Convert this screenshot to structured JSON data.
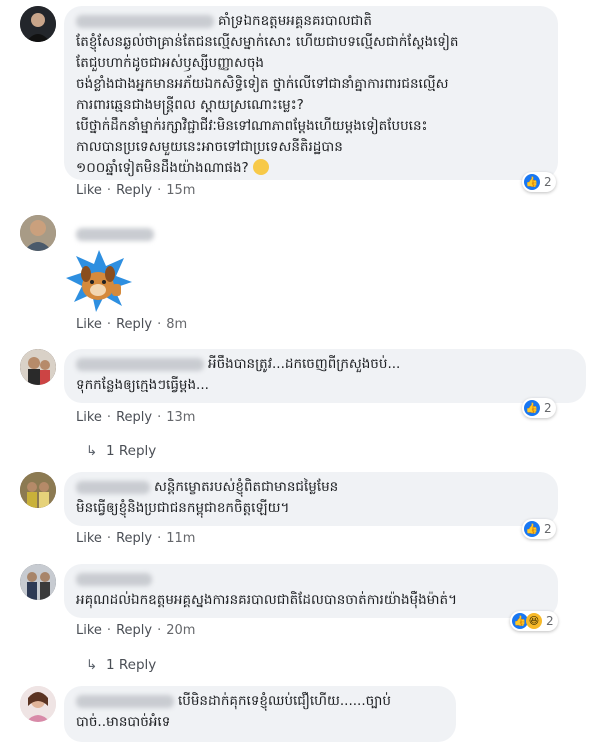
{
  "labels": {
    "like": "Like",
    "reply": "Reply",
    "dot": "·"
  },
  "comments": [
    {
      "lines": [
        "គាំទ្រឯកឧត្តមអគ្គនគរបាលជាតិ",
        "តែខ្ញុំសែនឆ្ងល់ថាគ្រាន់តែជនល្មើសម្នាក់សោះ ហើយជាបទល្មើសជាក់ស្តែងទៀត",
        "តែជួបហាក់ដូចជាអស់ឫស្សីបញ្ញាសចុង",
        "ចង់ខ្លាំងជាងអ្នកមានអភ័យឯកសិទ្ធិទៀត ថ្នាក់លើទៅជានាំគ្នាការពារជនល្មើស",
        "ការពារឆ្មេនជាងមន្ត្រីពល ស្តាយស្រណោះម្លេះ?",
        "បើថ្នាក់ដឹកនាំម្នាក់រក្សាវិជ្ជាជីវៈមិនទៅណាភាពម្តែងហើយម្តងទៀតបែបនេះ",
        "កាលបានប្រទេសមួយនេះអាចទៅជាប្រទេសនីតិរដ្ឋបាន",
        "១០០ឆ្នាំទៀតមិនដឹងយ៉ាងណាផង?"
      ],
      "time": "15m",
      "reactions": "2"
    },
    {
      "time": "8m"
    },
    {
      "lines": [
        "អីចឹងបានត្រូវ...ដកចេញពីក្រសួងចប់...",
        "ទុកកន្លែងឲ្យក្មេងៗធ្វើម្តង..."
      ],
      "time": "13m",
      "reactions": "2",
      "replies": "1 Reply"
    },
    {
      "lines": [
        "សន្តិកម្ខោតរបស់ខ្ញុំពិតជាមានជម្លៃមែន",
        "មិនធ្វើឲ្យខ្ញុំនិងប្រជាជនកម្ពុជាខកចិត្តឡើយ។"
      ],
      "time": "11m",
      "reactions": "2"
    },
    {
      "lines": [
        "អគុណដល់ឯកឧត្តមអគ្គស្នងការនគរបាលជាតិដែលបានចាត់ការយ៉ាងម៉ឺងម៉ាត់។"
      ],
      "time": "20m",
      "reactions": "2",
      "replies": "1 Reply"
    },
    {
      "lines": [
        "បើមិនដាក់គុកទេខ្ញុំឈប់ជឿហើយ......ច្បាប់",
        "បាច់..មានបាច់អំទេ"
      ]
    }
  ]
}
